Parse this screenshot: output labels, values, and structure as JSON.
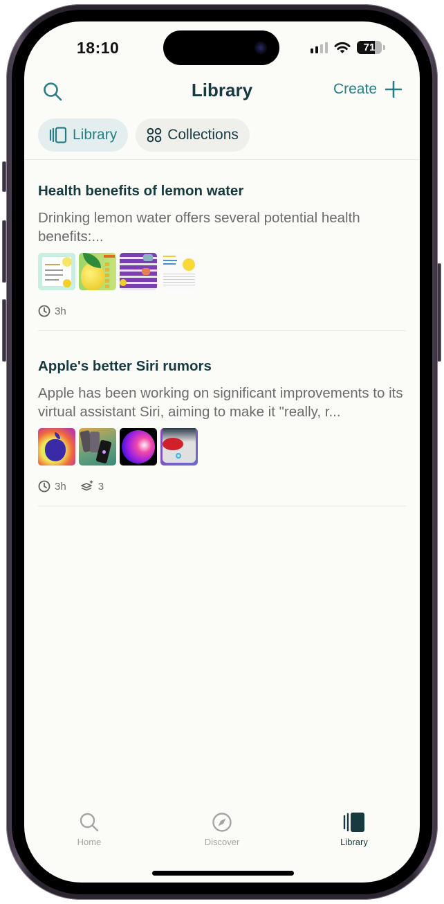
{
  "status_bar": {
    "time": "18:10",
    "battery_level": "71",
    "battery_fraction": 0.71,
    "signal_bars_active": 2,
    "signal_bars_total": 4
  },
  "header": {
    "title": "Library",
    "create_label": "Create",
    "search_icon": "search-icon",
    "plus_icon": "plus-icon"
  },
  "tabs": [
    {
      "label": "Library",
      "icon": "library-icon",
      "active": true
    },
    {
      "label": "Collections",
      "icon": "collections-icon",
      "active": false
    }
  ],
  "items": [
    {
      "title": "Health benefits of lemon water",
      "description": "Drinking lemon water offers several potential health benefits:...",
      "thumbnails": [
        "lemon-water-infographic",
        "lemon-fruit-health-benefits",
        "purple-benefits-list",
        "lemon-article-page"
      ],
      "time_ago": "3h",
      "sources_count": null
    },
    {
      "title": "Apple's better Siri rumors",
      "description": "Apple has been working on significant improvements to its virtual assistant Siri, aiming to make it \"really, r...",
      "thumbnails": [
        "rainbow-apple-logo",
        "iphones-siri",
        "siri-orb",
        "iphone-siri-screen"
      ],
      "time_ago": "3h",
      "sources_count": "3"
    }
  ],
  "bottom_nav": [
    {
      "label": "Home",
      "icon": "search-icon",
      "active": false
    },
    {
      "label": "Discover",
      "icon": "compass-icon",
      "active": false
    },
    {
      "label": "Library",
      "icon": "library-icon",
      "active": true
    }
  ],
  "colors": {
    "accent": "#257e86",
    "title_text": "#173a40",
    "body_text": "#6b6b6b",
    "background": "#fbfbf8",
    "active_tab_bg": "#e4eeee",
    "inactive_tab_bg": "#efefeb"
  }
}
